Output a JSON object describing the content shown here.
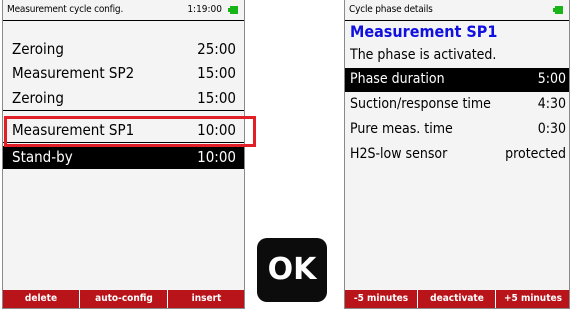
{
  "left_screen": {
    "title": "Measurement cycle config.",
    "time": "1:19:00",
    "rows": [
      {
        "label": "Zeroing",
        "value": "25:00"
      },
      {
        "label": "Measurement SP2",
        "value": "15:00"
      },
      {
        "label": "Zeroing",
        "value": "15:00"
      },
      {
        "label": "Measurement SP1",
        "value": "10:00"
      },
      {
        "label": "Stand-by",
        "value": "10:00"
      }
    ],
    "softkeys": [
      "delete",
      "auto-config",
      "insert"
    ]
  },
  "ok_key": {
    "label": "OK"
  },
  "right_screen": {
    "title": "Cycle phase details",
    "heading": "Measurement SP1",
    "status_text": "The phase is activated.",
    "rows": [
      {
        "label": "Phase duration",
        "value": "5:00"
      },
      {
        "label": "Suction/response time",
        "value": "4:30"
      },
      {
        "label": "Pure meas. time",
        "value": "0:30"
      },
      {
        "label": "H2S-low sensor",
        "value": "protected"
      }
    ],
    "softkeys": [
      "-5 minutes",
      "deactivate",
      "+5 minutes"
    ]
  },
  "colors": {
    "softkey_bar": "#b8141a",
    "highlight_box": "#e21f26",
    "heading_blue": "#1010e0",
    "battery": "#18b418"
  }
}
